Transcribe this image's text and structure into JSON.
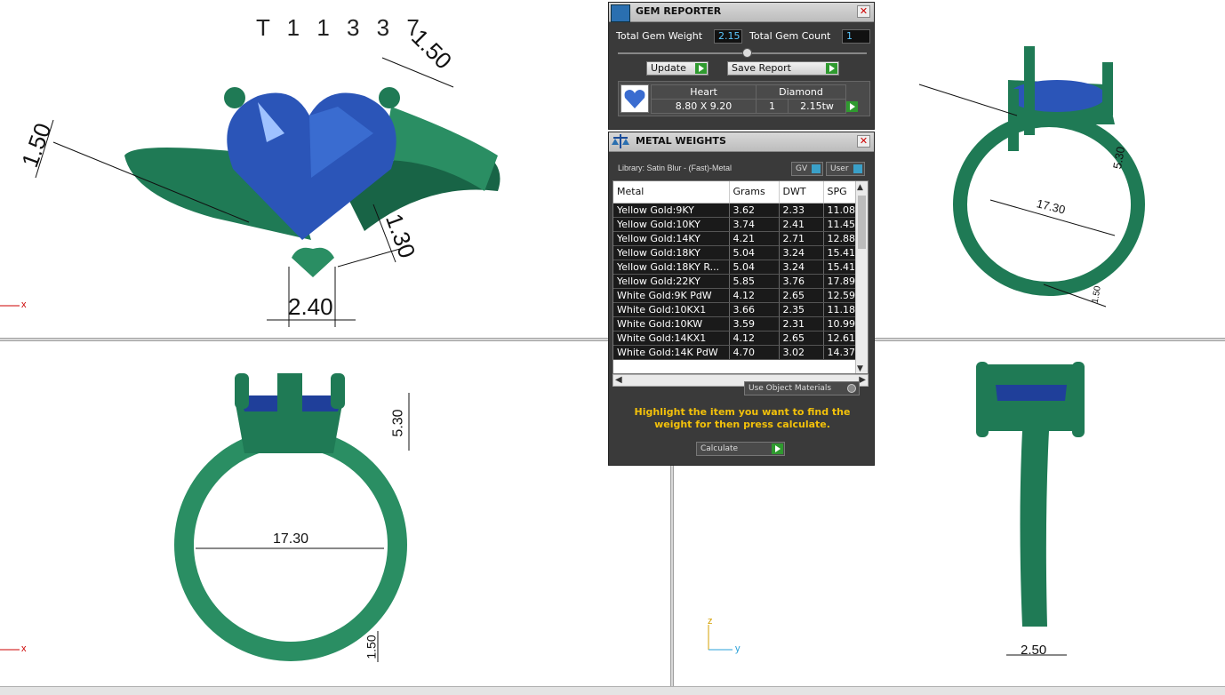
{
  "viewports": {
    "top_left": {
      "title": "T 1 1 3 3 7",
      "axis_x": "x"
    },
    "bottom_left": {
      "axis_x": "x"
    },
    "bottom_right": {
      "axis_y": "y",
      "axis_z": "z"
    }
  },
  "dimensions": {
    "tl_1": "1.50",
    "tl_2": "1.50",
    "tl_3": "1.30",
    "tl_4": "2.40",
    "tr_1": "17.30",
    "tr_2": "5.30",
    "tr_3": "1.50",
    "bl_1": "5.30",
    "bl_2": "17.30",
    "bl_3": "1.50",
    "br_1": "2.50"
  },
  "gem_reporter": {
    "title": "GEM REPORTER",
    "close": "✕",
    "total_gem_weight_label": "Total Gem Weight",
    "total_gem_weight_value": "2.15",
    "total_gem_count_label": "Total Gem Count",
    "total_gem_count_value": "1",
    "update_label": "Update",
    "save_report_label": "Save Report",
    "gem": {
      "shape": "Heart",
      "size": "8.80 X 9.20",
      "type": "Diamond",
      "count": "1",
      "weight": "2.15tw"
    }
  },
  "metal_weights": {
    "title": "METAL WEIGHTS",
    "close": "✕",
    "library_label": "Library: Satin Blur - (Fast)-Metal",
    "gv_label": "GV",
    "user_label": "User",
    "columns": [
      "Metal",
      "Grams",
      "DWT",
      "SPG"
    ],
    "rows": [
      [
        "Yellow Gold:9KY",
        "3.62",
        "2.33",
        "11.08"
      ],
      [
        "Yellow Gold:10KY",
        "3.74",
        "2.41",
        "11.45"
      ],
      [
        "Yellow Gold:14KY",
        "4.21",
        "2.71",
        "12.88"
      ],
      [
        "Yellow Gold:18KY",
        "5.04",
        "3.24",
        "15.41"
      ],
      [
        "Yellow Gold:18KY R...",
        "5.04",
        "3.24",
        "15.41"
      ],
      [
        "Yellow Gold:22KY",
        "5.85",
        "3.76",
        "17.89"
      ],
      [
        "White Gold:9K PdW",
        "4.12",
        "2.65",
        "12.59"
      ],
      [
        "White Gold:10KX1",
        "3.66",
        "2.35",
        "11.18"
      ],
      [
        "White Gold:10KW",
        "3.59",
        "2.31",
        "10.99"
      ],
      [
        "White Gold:14KX1",
        "4.12",
        "2.65",
        "12.61"
      ],
      [
        "White Gold:14K PdW",
        "4.70",
        "3.02",
        "14.37"
      ]
    ],
    "use_object_materials_label": "Use Object Materials",
    "instruction": "Highlight the item you want to find the weight for then press calculate.",
    "calculate_label": "Calculate"
  },
  "colors": {
    "ring": "#1f7a55",
    "gem": "#2b55b8",
    "panel_bg": "#3a3a3a",
    "accent_yellow": "#f3c10a",
    "value_blue": "#5cc8ff"
  }
}
